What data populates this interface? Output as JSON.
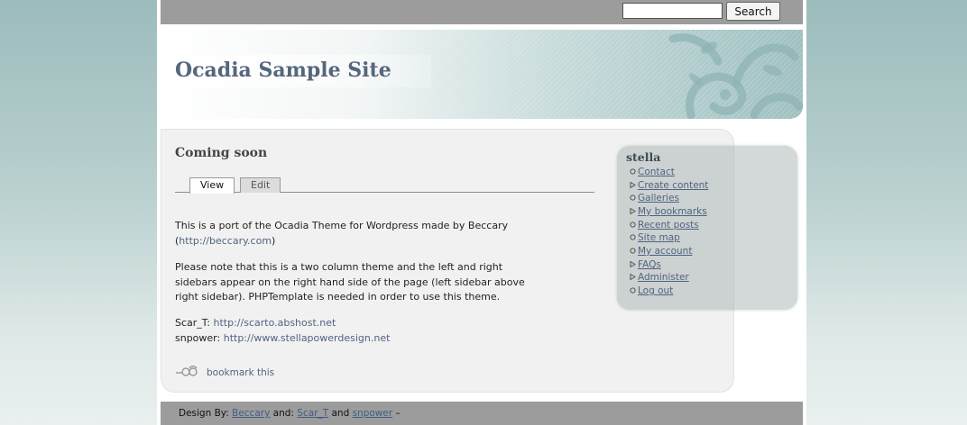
{
  "search": {
    "value": "",
    "placeholder": "",
    "button_label": "Search"
  },
  "header": {
    "site_title": "Ocadia Sample Site"
  },
  "content": {
    "title": "Coming soon",
    "tabs": [
      {
        "label": "View",
        "active": true
      },
      {
        "label": "Edit",
        "active": false
      }
    ],
    "paragraph1": {
      "line1": "This is a port of the Ocadia Theme for Wordpress made by Beccary",
      "open_paren": "(",
      "link": "http://beccary.com",
      "close_paren": ")"
    },
    "paragraph2": {
      "line1": "Please note that this is a two column theme and the left and right",
      "line2": "sidebars appear on the right hand side of the page (left sidebar above",
      "line3": "right sidebar). PHPTemplate is needed in order to use this theme."
    },
    "credits": [
      {
        "label": "Scar_T: ",
        "link": "http://scarto.abshost.net"
      },
      {
        "label": "snpower: ",
        "link": "http://www.stellapowerdesign.net"
      }
    ],
    "bookmark_label": "bookmark this"
  },
  "sidebar": {
    "title": "stella",
    "items": [
      {
        "label": "Contact",
        "bullet": "circle"
      },
      {
        "label": "Create content",
        "bullet": "triangle"
      },
      {
        "label": "Galleries",
        "bullet": "circle"
      },
      {
        "label": "My bookmarks",
        "bullet": "triangle"
      },
      {
        "label": "Recent posts",
        "bullet": "circle"
      },
      {
        "label": "Site map",
        "bullet": "circle"
      },
      {
        "label": "My account",
        "bullet": "circle"
      },
      {
        "label": "FAQs",
        "bullet": "triangle"
      },
      {
        "label": "Administer",
        "bullet": "triangle"
      },
      {
        "label": "Log out",
        "bullet": "circle"
      }
    ]
  },
  "footer": {
    "design_by": "Design By: ",
    "designer1": "Beccary",
    "and1": " and: ",
    "designer2": "Scar_T",
    "and2": " and ",
    "designer3": "snpower",
    "suffix": " –"
  },
  "colors": {
    "title": "#55677c",
    "link": "#4f6480",
    "bar": "#9c9c9c",
    "sidebar_bg": "#aab4b4"
  }
}
